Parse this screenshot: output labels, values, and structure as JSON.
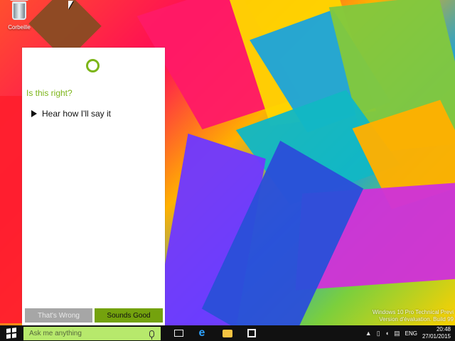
{
  "desktop": {
    "recycle_bin_label": "Corbeille",
    "watermark_line1": "Windows 10 Pro Technical Previ",
    "watermark_line2": "Version d'évaluation. Build 99"
  },
  "cortana": {
    "question": "Is this right?",
    "hear_label": "Hear how I'll say it",
    "wrong_label": "That's Wrong",
    "good_label": "Sounds Good",
    "accent_color": "#7cb518"
  },
  "taskbar": {
    "search_placeholder": "Ask me anything",
    "language": "ENG",
    "time": "20:48",
    "date": "27/01/2015",
    "up_arrow": "▲",
    "network_symbol": "▯",
    "volume_symbol": "◖",
    "notification_symbol": "▤"
  }
}
